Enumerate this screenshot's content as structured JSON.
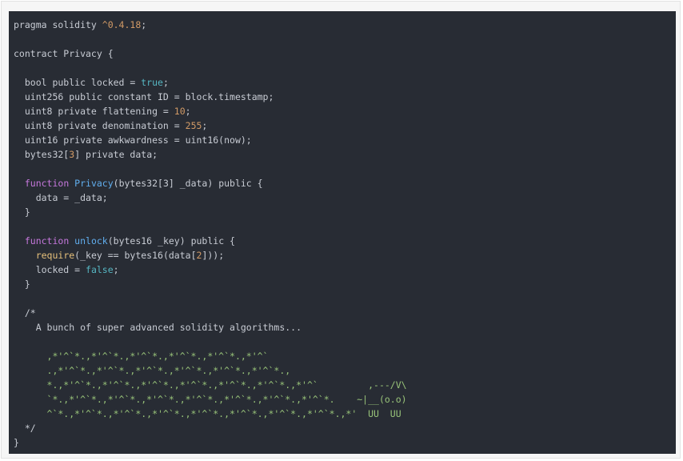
{
  "code_lines": [
    {
      "t": "pragma solidity ",
      "x": "^0.4.18",
      "y": ";"
    },
    {
      "t": ""
    },
    {
      "t": "contract Privacy {"
    },
    {
      "t": ""
    },
    {
      "t": "  bool public locked = ",
      "x": "true",
      "y": ";"
    },
    {
      "t": "  uint256 public constant ID = block.timestamp;"
    },
    {
      "t": "  uint8 private flattening = ",
      "x": "10",
      "y": ";"
    },
    {
      "t": "  uint8 private denomination = ",
      "x": "255",
      "y": ";"
    },
    {
      "t": "  uint16 private awkwardness = uint16(now);"
    },
    {
      "t": "  bytes32[",
      "x": "3",
      "y": "] private data;"
    },
    {
      "t": ""
    },
    {
      "t": "  ",
      "k": "function",
      "f": " Privacy",
      "y": "(bytes32[3] _data) public {"
    },
    {
      "t": "    data = _data;"
    },
    {
      "t": "  }"
    },
    {
      "t": ""
    },
    {
      "t": "  ",
      "k": "function",
      "f": " unlock",
      "y": "(bytes16 _key) public {"
    },
    {
      "t": "    ",
      "r": "require",
      "y": "(_key == bytes16(data[",
      "x": "2",
      "z": "]));"
    },
    {
      "t": "    locked = ",
      "b": "false",
      "y": ";"
    },
    {
      "t": "  }"
    },
    {
      "t": ""
    },
    {
      "t": "  /*"
    },
    {
      "t": "    A bunch of super advanced solidity algorithms..."
    },
    {
      "t": ""
    },
    {
      "t": "      ,*'^`*.,*'^`*.,*'^`*.,*'^`*.,*'^`*.,*'^`"
    },
    {
      "t": "      .,*'^`*.,*'^`*.,*'^`*.,*'^`*.,*'^`*.,*'^`*.,"
    },
    {
      "t": "      *.,*'^`*.,*'^`*.,*'^`*.,*'^`*.,*'^`*.,*'^`*.,*'^`         ,---/V\\"
    },
    {
      "t": "      `*.,*'^`*.,*'^`*.,*'^`*.,*'^`*.,*'^`*.,*'^`*.,*'^`*.    ~|__(o.o)"
    },
    {
      "t": "      ^`*.,*'^`*.,*'^`*.,*'^`*.,*'^`*.,*'^`*.,*'^`*.,*'^`*.,*'  UU  UU"
    },
    {
      "t": "  */"
    },
    {
      "t": "}"
    }
  ]
}
